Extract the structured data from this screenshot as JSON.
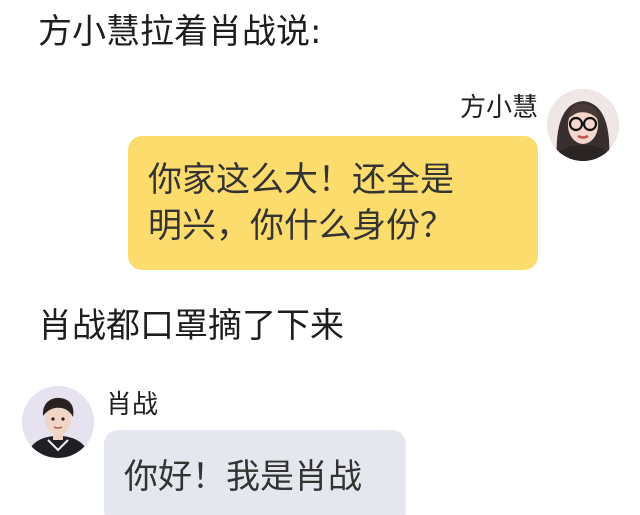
{
  "narration": {
    "line1": "方小慧拉着肖战说:",
    "line2": "肖战都口罩摘了下来"
  },
  "messages": [
    {
      "sender": "方小慧",
      "side": "right",
      "bubble_color": "#fcdc6d",
      "avatar_icon": "woman-with-glasses-avatar",
      "lines": [
        "你家这么大！还全是",
        "明兴，你什么身份？"
      ]
    },
    {
      "sender": "肖战",
      "side": "left",
      "bubble_color": "#e4e7ed",
      "avatar_icon": "man-avatar",
      "text": "你好！我是肖战"
    }
  ]
}
